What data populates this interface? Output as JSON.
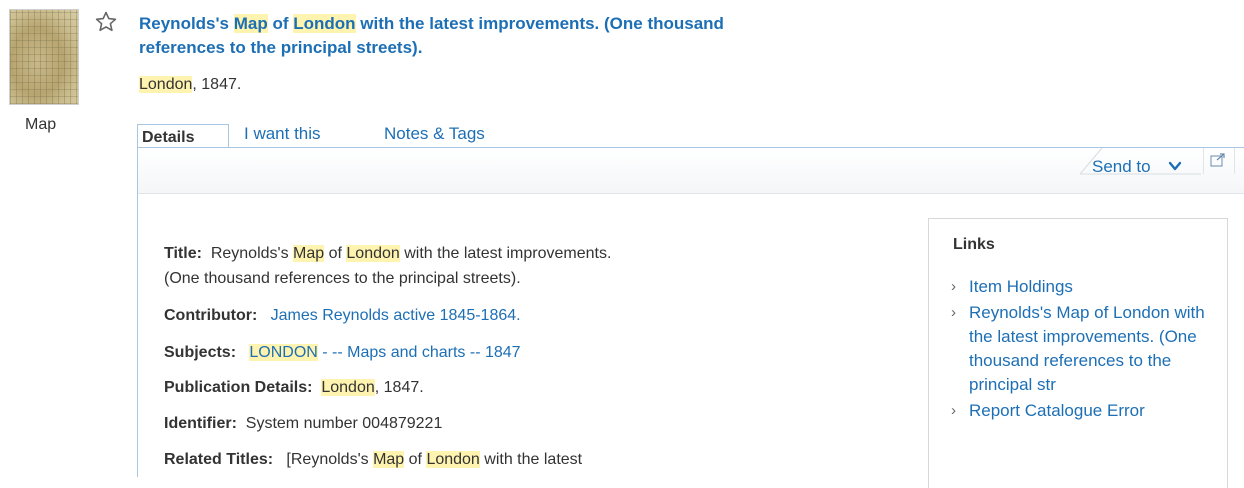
{
  "record": {
    "thumbnail_label": "Map",
    "title_parts": [
      "Reynolds's ",
      "Map",
      " of ",
      "London",
      " with the latest improvements. (One thousand references to the principal streets)."
    ],
    "pub_parts": [
      "London",
      ", 1847."
    ]
  },
  "tabs": [
    "Details",
    "I want this",
    "Notes & Tags"
  ],
  "toolbar": {
    "send_to": "Send to"
  },
  "details": {
    "title_label": "Title:",
    "title_parts": [
      "Reynolds's ",
      "Map",
      " of ",
      "London",
      " with the latest improvements."
    ],
    "title_line2": "(One thousand references to the principal streets).",
    "contributor_label": "Contributor:",
    "contributor_value": "James Reynolds active 1845-1864.",
    "subjects_label": "Subjects:",
    "subjects_parts": [
      "LONDON",
      " - -- Maps and charts -- 1847"
    ],
    "pubdetails_label": "Publication Details:",
    "pubdetails_parts": [
      "London",
      ", 1847."
    ],
    "identifier_label": "Identifier:",
    "identifier_value": "System number 004879221",
    "related_label": "Related Titles:",
    "related_parts": [
      "[Reynolds's ",
      "Map",
      " of ",
      "London",
      " with the latest"
    ]
  },
  "links": {
    "title": "Links",
    "items": [
      "Item Holdings",
      "Reynolds's Map of London with the latest improvements. (One thousand references to the principal str",
      "Report Catalogue Error"
    ]
  },
  "colors": {
    "link": "#1d6fb5",
    "highlight": "#fff3b0",
    "tab_border": "#a8c6e2"
  },
  "icons": [
    "star-outline-icon",
    "chevron-down-icon",
    "popout-icon",
    "chevron-right-icon"
  ]
}
